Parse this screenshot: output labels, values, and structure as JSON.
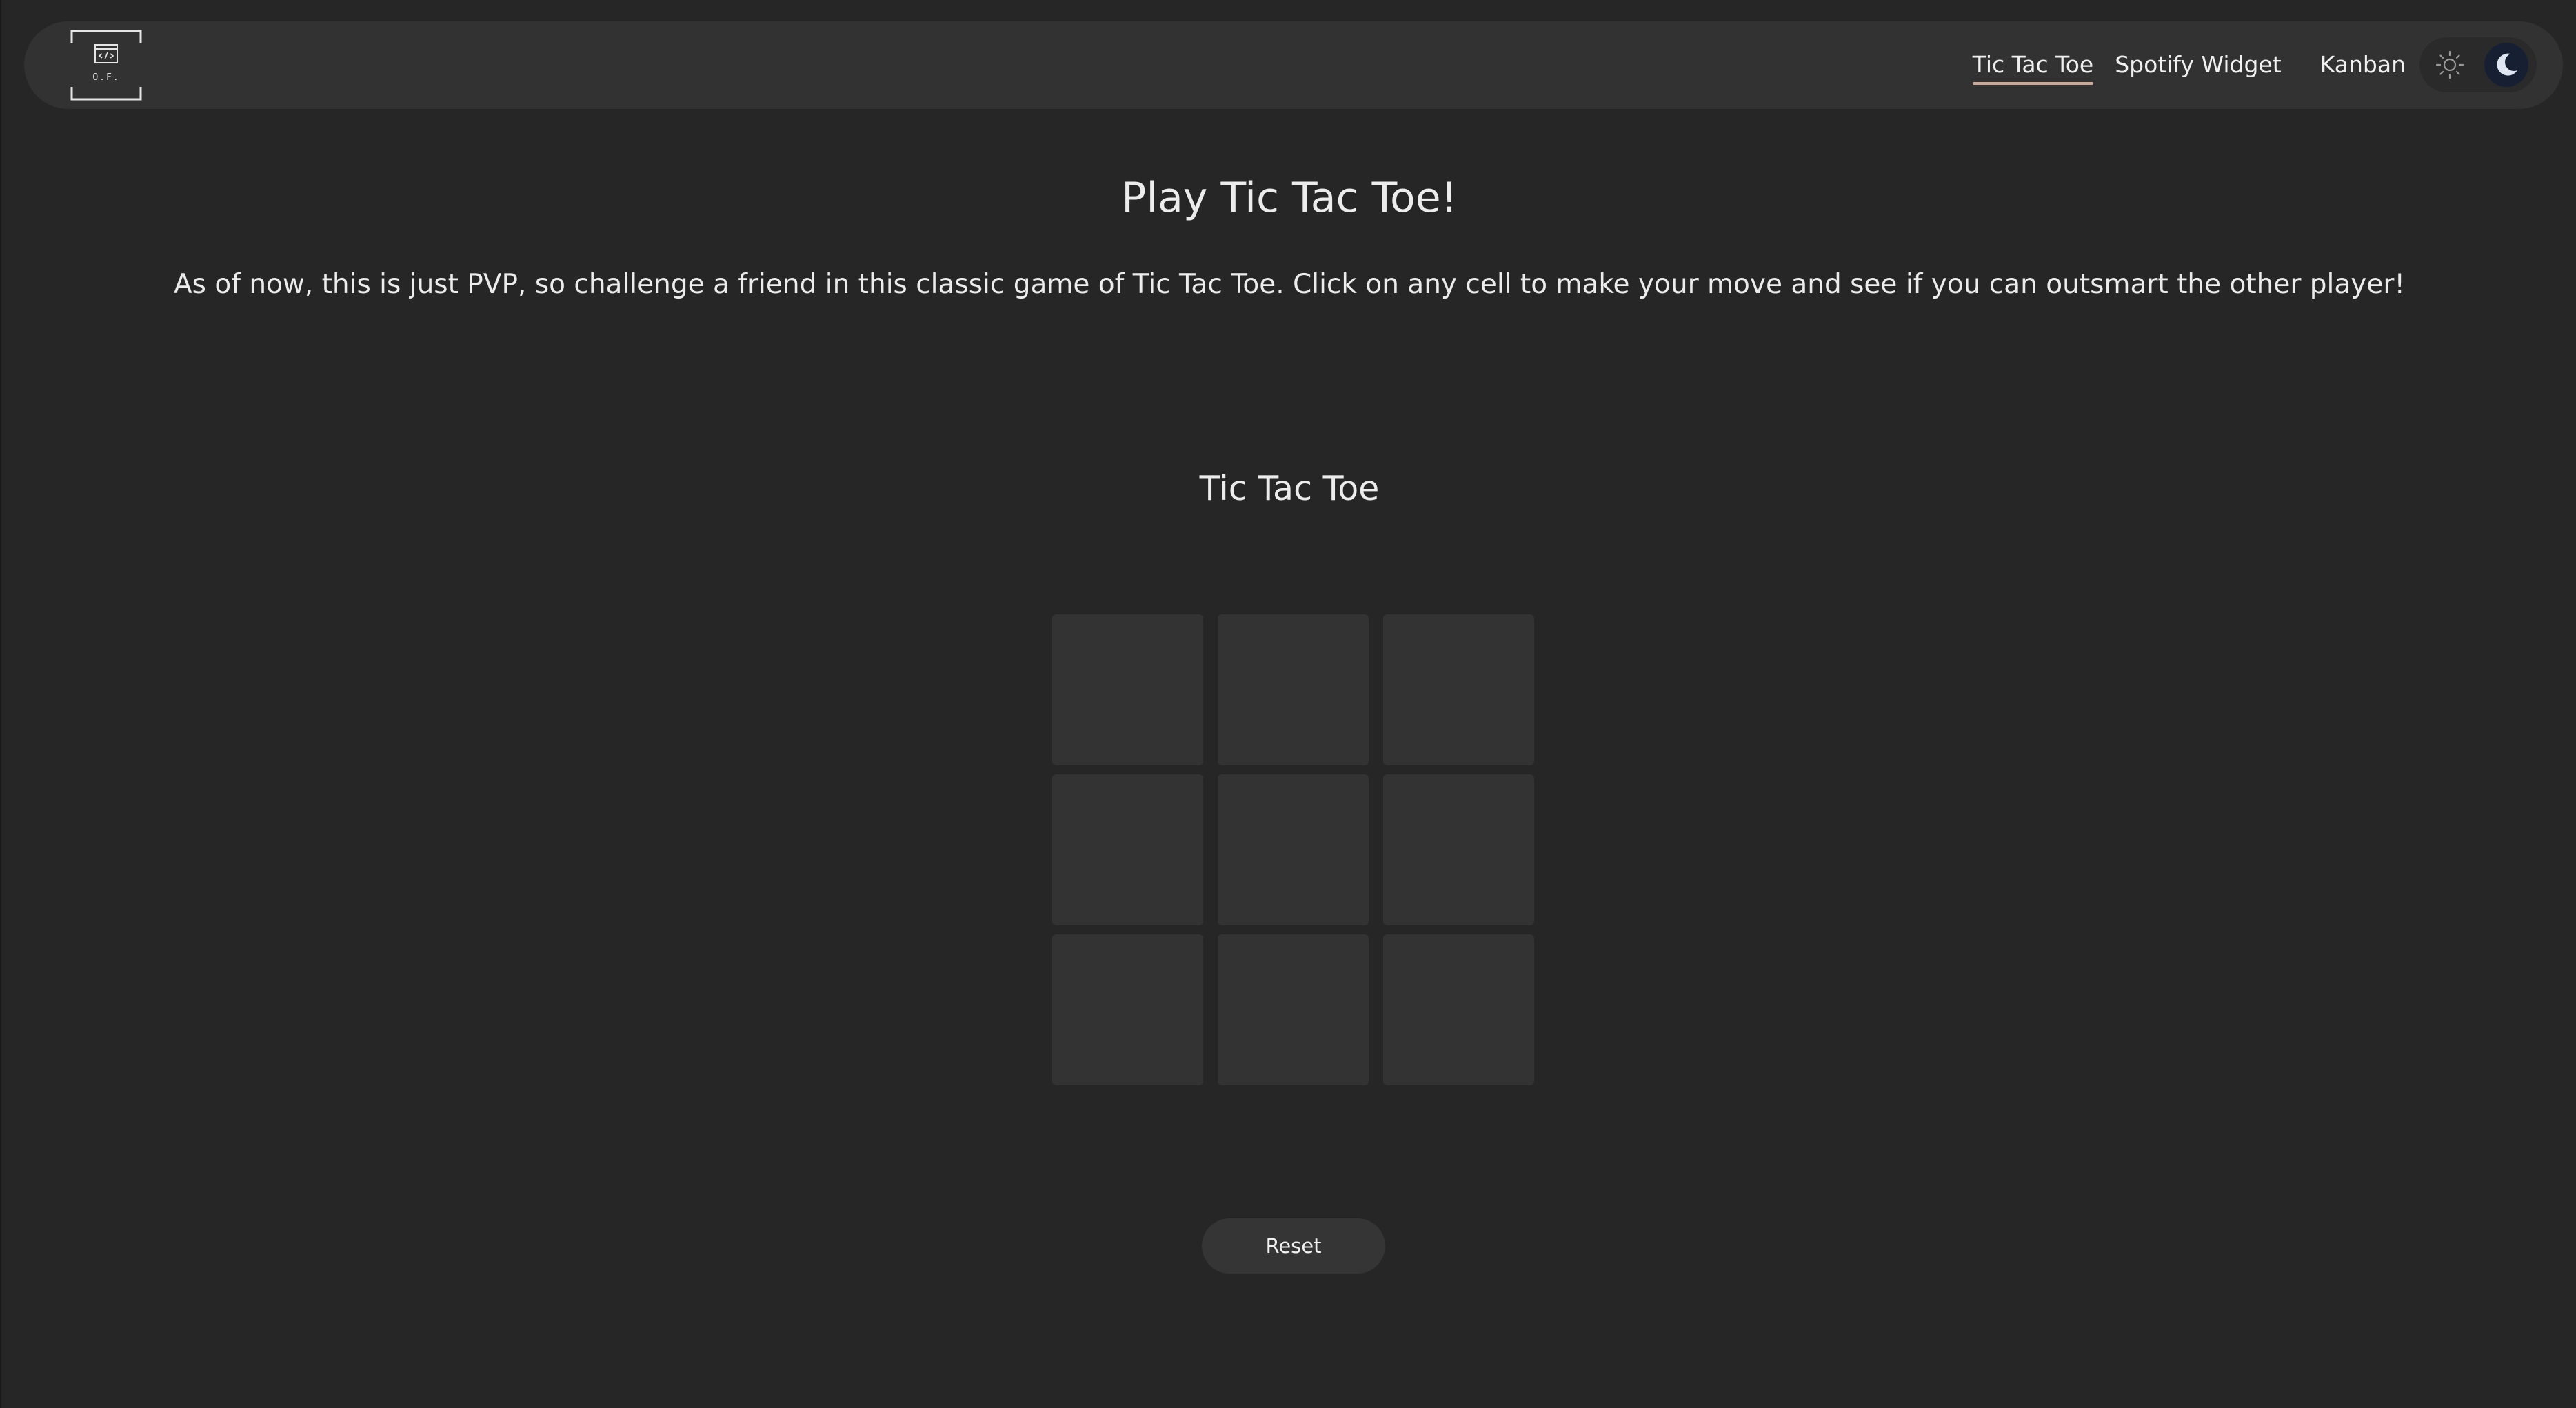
{
  "navbar": {
    "logo_text": "O.F.",
    "logo_icon": "code-window-icon",
    "links": [
      {
        "label": "Tic Tac Toe",
        "active": true
      },
      {
        "label": "Spotify Widget",
        "active": false
      },
      {
        "label": "Kanban",
        "active": false
      }
    ],
    "theme": {
      "light_icon": "sun-icon",
      "dark_icon": "moon-icon",
      "selected": "dark"
    }
  },
  "hero": {
    "title": "Play Tic Tac Toe!",
    "description": "As of now, this is just PVP, so challenge a friend in this classic game of Tic Tac Toe. Click on any cell to make your move and see if you can outsmart the other player!"
  },
  "game": {
    "title": "Tic Tac Toe",
    "cells": [
      "",
      "",
      "",
      "",
      "",
      "",
      "",
      "",
      ""
    ],
    "reset_label": "Reset"
  },
  "colors": {
    "background": "#262626",
    "surface": "#323232",
    "cell": "#333333",
    "active_underline": "#c9a996",
    "moon_button": "#172033"
  }
}
